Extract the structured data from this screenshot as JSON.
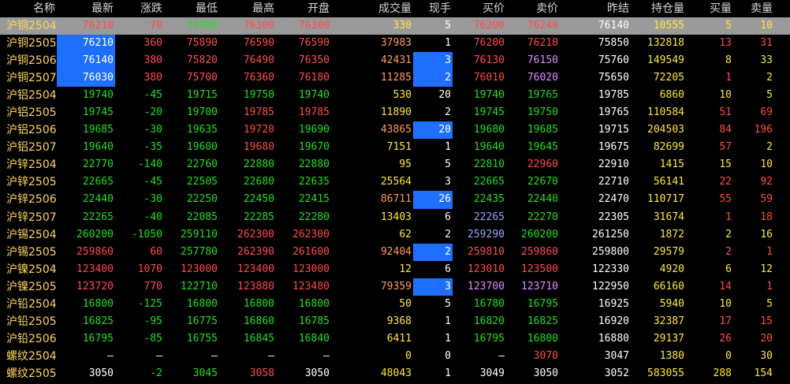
{
  "headers": [
    "名称",
    "最新",
    "涨跌",
    "最低",
    "最高",
    "开盘",
    "成交量",
    "现手",
    "买价",
    "卖价",
    "昨结",
    "持仓量",
    "买量",
    "卖量"
  ],
  "rows": [
    {
      "name": "沪铜2504",
      "c": [
        "76210",
        "70",
        "75980",
        "76300",
        "76300",
        "330",
        "5",
        "76200",
        "76240",
        "76140",
        "10555",
        "5",
        "10"
      ]
    },
    {
      "name": "沪铜2505",
      "c": [
        "76210",
        "360",
        "75890",
        "76590",
        "76590",
        "37983",
        "1",
        "76200",
        "76210",
        "75850",
        "132818",
        "13",
        "31"
      ]
    },
    {
      "name": "沪铜2506",
      "c": [
        "76140",
        "380",
        "75820",
        "76490",
        "76350",
        "42431",
        "3",
        "76130",
        "76150",
        "75760",
        "149549",
        "8",
        "33"
      ]
    },
    {
      "name": "沪铜2507",
      "c": [
        "76030",
        "380",
        "75700",
        "76360",
        "76180",
        "11285",
        "2",
        "76010",
        "76020",
        "75650",
        "72205",
        "1",
        "2"
      ]
    },
    {
      "name": "沪铝2504",
      "c": [
        "19740",
        "-45",
        "19715",
        "19750",
        "19740",
        "530",
        "20",
        "19740",
        "19765",
        "19785",
        "6860",
        "10",
        "5"
      ]
    },
    {
      "name": "沪铝2505",
      "c": [
        "19745",
        "-20",
        "19700",
        "19785",
        "19785",
        "11890",
        "2",
        "19745",
        "19750",
        "19765",
        "110584",
        "51",
        "69"
      ]
    },
    {
      "name": "沪铝2506",
      "c": [
        "19685",
        "-30",
        "19635",
        "19720",
        "19690",
        "43865",
        "20",
        "19680",
        "19685",
        "19715",
        "204503",
        "84",
        "196"
      ]
    },
    {
      "name": "沪铝2507",
      "c": [
        "19640",
        "-35",
        "19600",
        "19680",
        "19670",
        "7151",
        "1",
        "19640",
        "19645",
        "19675",
        "82699",
        "57",
        "2"
      ]
    },
    {
      "name": "沪锌2504",
      "c": [
        "22770",
        "-140",
        "22760",
        "22880",
        "22880",
        "95",
        "5",
        "22810",
        "22960",
        "22910",
        "1415",
        "15",
        "10"
      ]
    },
    {
      "name": "沪锌2505",
      "c": [
        "22665",
        "-45",
        "22505",
        "22680",
        "22635",
        "25564",
        "3",
        "22665",
        "22670",
        "22710",
        "56141",
        "22",
        "92"
      ]
    },
    {
      "name": "沪锌2506",
      "c": [
        "22440",
        "-30",
        "22250",
        "22450",
        "22415",
        "86711",
        "26",
        "22435",
        "22440",
        "22470",
        "110717",
        "55",
        "59"
      ]
    },
    {
      "name": "沪锌2507",
      "c": [
        "22265",
        "-40",
        "22085",
        "22285",
        "22280",
        "13403",
        "6",
        "22265",
        "22270",
        "22305",
        "31674",
        "1",
        "18"
      ]
    },
    {
      "name": "沪锡2504",
      "c": [
        "260200",
        "-1050",
        "259110",
        "262300",
        "262300",
        "62",
        "2",
        "259290",
        "260200",
        "261250",
        "1872",
        "2",
        "16"
      ]
    },
    {
      "name": "沪锡2505",
      "c": [
        "259860",
        "60",
        "257780",
        "262390",
        "261600",
        "92404",
        "2",
        "259810",
        "259860",
        "259800",
        "29579",
        "2",
        "1"
      ]
    },
    {
      "name": "沪镍2504",
      "c": [
        "123400",
        "1070",
        "123000",
        "123400",
        "123000",
        "12",
        "6",
        "123010",
        "123500",
        "122330",
        "4920",
        "6",
        "12"
      ]
    },
    {
      "name": "沪镍2505",
      "c": [
        "123720",
        "770",
        "122710",
        "123880",
        "123480",
        "79359",
        "3",
        "123700",
        "123710",
        "122950",
        "66160",
        "14",
        "1"
      ]
    },
    {
      "name": "沪铅2504",
      "c": [
        "16800",
        "-125",
        "16800",
        "16800",
        "16800",
        "50",
        "5",
        "16780",
        "16795",
        "16925",
        "5940",
        "10",
        "5"
      ]
    },
    {
      "name": "沪铅2505",
      "c": [
        "16825",
        "-95",
        "16775",
        "16860",
        "16785",
        "9368",
        "1",
        "16820",
        "16825",
        "16920",
        "32387",
        "17",
        "15"
      ]
    },
    {
      "name": "沪铅2506",
      "c": [
        "16795",
        "-85",
        "16755",
        "16845",
        "16840",
        "6411",
        "1",
        "16795",
        "16800",
        "16880",
        "29137",
        "26",
        "20"
      ]
    },
    {
      "name": "螺纹2504",
      "c": [
        "—",
        "—",
        "—",
        "—",
        "—",
        "0",
        "0",
        "—",
        "3070",
        "3047",
        "1380",
        "0",
        "30"
      ]
    },
    {
      "name": "螺纹2505",
      "c": [
        "3050",
        "-2",
        "3045",
        "3058",
        "3050",
        "48043",
        "1",
        "3049",
        "3050",
        "3052",
        "583055",
        "288",
        "154"
      ]
    }
  ],
  "colors": {
    "up": "#ff4b4b",
    "down": "#1ee01e",
    "vol": "#ffe83a",
    "highlight": "#1f6fff",
    "selected_row": "#9a9a9a"
  }
}
